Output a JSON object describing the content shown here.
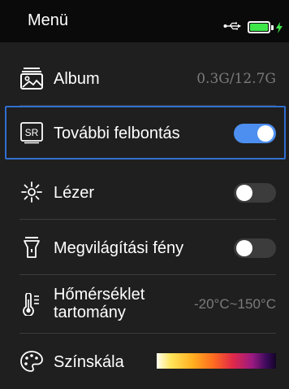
{
  "header": {
    "title": "Menü",
    "usb_icon": "usb-icon",
    "battery_icon": "battery-charging-icon",
    "battery_color": "#3ee64a"
  },
  "menu": {
    "album": {
      "label": "Album",
      "value": "0.3G/12.7G",
      "icon": "album-image-icon"
    },
    "super_resolution": {
      "label": "További felbontás",
      "icon": "sr-icon",
      "icon_text": "SR",
      "toggle_on": true
    },
    "laser": {
      "label": "Lézer",
      "icon": "laser-icon",
      "toggle_on": false
    },
    "light": {
      "label": "Megvilágítási fény",
      "icon": "flashlight-icon",
      "toggle_on": false
    },
    "temperature": {
      "label_line1": "Hőmérséklet",
      "label_line2": "tartomány",
      "value": "-20°C~150°C",
      "icon": "thermometer-icon"
    },
    "palette": {
      "label": "Színskála",
      "icon": "palette-icon"
    }
  },
  "colors": {
    "accent": "#4c8ff0",
    "selection_border": "#2f6fd0",
    "value_gray": "#7b7b7b"
  }
}
